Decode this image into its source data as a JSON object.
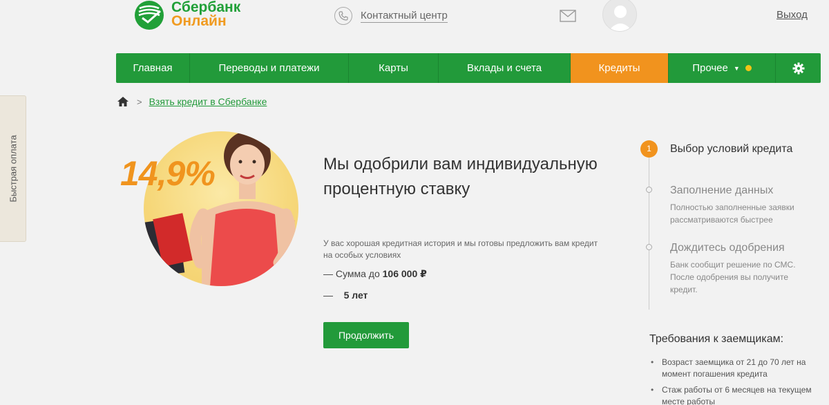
{
  "header": {
    "logo_line1": "Сбербанк",
    "logo_line2": "Онлайн",
    "contact_center": "Контактный центр",
    "logout": "Выход"
  },
  "nav": {
    "items": [
      {
        "label": "Главная",
        "active": false
      },
      {
        "label": "Переводы и платежи",
        "active": false
      },
      {
        "label": "Карты",
        "active": false
      },
      {
        "label": "Вклады и счета",
        "active": false
      },
      {
        "label": "Кредиты",
        "active": true
      },
      {
        "label": "Прочее",
        "active": false
      }
    ],
    "settings_icon": "gear-icon"
  },
  "side_tab": {
    "label": "Быстрая оплата"
  },
  "breadcrumb": {
    "link": "Взять кредит в Сбербанке"
  },
  "promo": {
    "rate": "14,9%",
    "heading": "Мы одобрили вам индивидуальную процентную ставку",
    "description": "У вас хорошая кредитная история и мы готовы предложить вам кредит на особых условиях",
    "amount_prefix": "— Сумма до",
    "amount_value": "106 000 ₽",
    "term_prefix": "—",
    "term_value": "5 лет",
    "button": "Продолжить"
  },
  "steps": {
    "items": [
      {
        "number": "1",
        "title": "Выбор условий кредита",
        "description": ""
      },
      {
        "number": "",
        "title": "Заполнение данных",
        "description": "Полностью заполненные заявки рассматриваются быстрее"
      },
      {
        "number": "",
        "title": "Дождитесь одобрения",
        "description": "Банк сообщит решение по СМС. После одобрения вы получите кредит."
      }
    ]
  },
  "requirements": {
    "title": "Требования к заемщикам:",
    "items": [
      "Возраст заемщика от 21 до 70 лет на момент погашения кредита",
      "Стаж работы от 6 месяцев на текущем месте работы"
    ]
  },
  "colors": {
    "brand_green": "#229a3a",
    "accent_orange": "#f1931e"
  }
}
